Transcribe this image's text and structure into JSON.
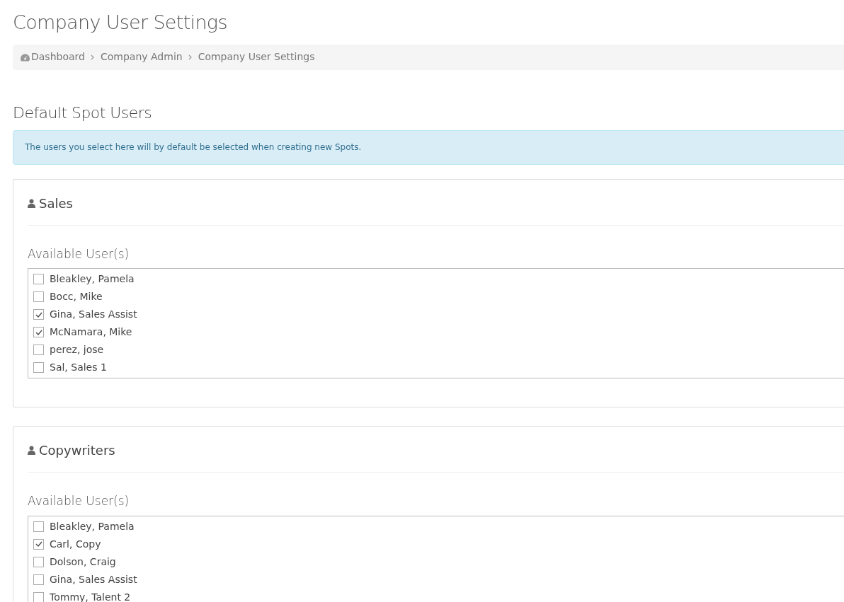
{
  "page_title": "Company User Settings",
  "breadcrumb": [
    "Dashboard",
    "Company Admin",
    "Company User Settings"
  ],
  "section_title": "Default Spot Users",
  "info_alert": "The users you select here will by default be selected when creating new Spots.",
  "groups": [
    {
      "title": "Sales",
      "list_label": "Available User(s)",
      "users": [
        {
          "name": "Bleakley, Pamela",
          "checked": false
        },
        {
          "name": "Bocc, Mike",
          "checked": false
        },
        {
          "name": "Gina, Sales Assist",
          "checked": true
        },
        {
          "name": "McNamara, Mike",
          "checked": true
        },
        {
          "name": "perez, jose",
          "checked": false
        },
        {
          "name": "Sal, Sales 1",
          "checked": false
        }
      ]
    },
    {
      "title": "Copywriters",
      "list_label": "Available User(s)",
      "users": [
        {
          "name": "Bleakley, Pamela",
          "checked": false
        },
        {
          "name": "Carl, Copy",
          "checked": true
        },
        {
          "name": "Dolson, Craig",
          "checked": false
        },
        {
          "name": "Gina, Sales Assist",
          "checked": false
        },
        {
          "name": "Tommy, Talent 2",
          "checked": false
        }
      ]
    }
  ]
}
